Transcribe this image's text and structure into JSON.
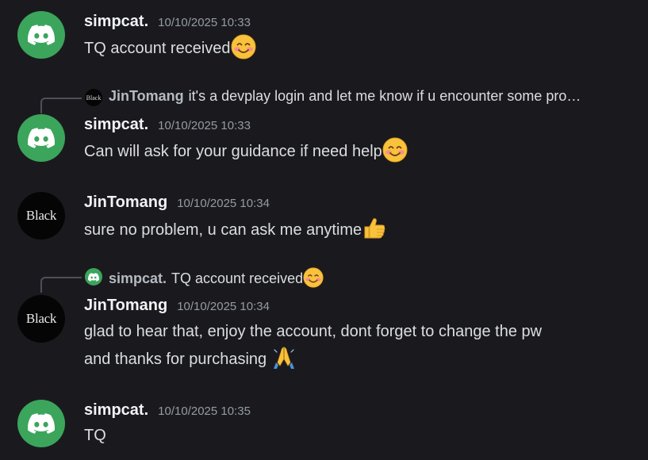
{
  "messages": [
    {
      "author": "simpcat.",
      "timestamp": "10/10/2025 10:33",
      "content": "TQ account received",
      "avatar_icon": "discord-logo-icon",
      "emoji_icon": "smiling-face-icon"
    },
    {
      "reply": {
        "author": "JinTomang",
        "preview": "it's a devplay login and let me know if u encounter some pro…",
        "avatar_text": "Black"
      },
      "author": "simpcat.",
      "timestamp": "10/10/2025 10:33",
      "content": "Can will ask for your guidance if need help",
      "avatar_icon": "discord-logo-icon",
      "emoji_icon": "smiling-face-icon"
    },
    {
      "author": "JinTomang",
      "timestamp": "10/10/2025 10:34",
      "content": "sure no problem, u can ask me anytime",
      "avatar_text": "Black",
      "emoji_icon": "thumbs-up-icon"
    },
    {
      "reply": {
        "author": "simpcat.",
        "preview": "TQ account received",
        "avatar_icon": "discord-logo-icon",
        "emoji_icon": "smiling-face-icon"
      },
      "author": "JinTomang",
      "timestamp": "10/10/2025 10:34",
      "content_line1": "glad to hear that, enjoy the account, dont forget to change the pw",
      "content_line2": "and thanks for purchasing",
      "avatar_text": "Black",
      "emoji_icon": "folded-hands-icon"
    },
    {
      "author": "simpcat.",
      "timestamp": "10/10/2025 10:35",
      "content": "TQ",
      "avatar_icon": "discord-logo-icon"
    }
  ],
  "colors": {
    "background": "#1a1a1e",
    "discord_green": "#3ba55c",
    "username": "#f2f3f5",
    "timestamp": "#949ba4",
    "text": "#dbdee1"
  }
}
